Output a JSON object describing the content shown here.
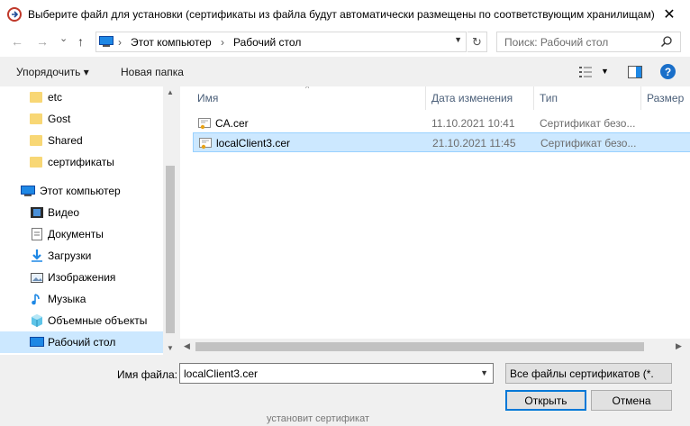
{
  "window": {
    "title": "Выберите файл для установки (сертификаты из файла будут автоматически размещены по соответствующим хранилищам)",
    "close_glyph": "✕"
  },
  "nav": {
    "back_glyph": "←",
    "forward_glyph": "→",
    "recent_glyph": "⌄",
    "up_glyph": "↑",
    "breadcrumbs": [
      "Этот компьютер",
      "Рабочий стол"
    ],
    "crumb_separator": "›",
    "refresh_glyph": "↻",
    "search_placeholder": "Поиск: Рабочий стол"
  },
  "toolbar": {
    "organize_label": "Упорядочить ▾",
    "new_folder_label": "Новая папка",
    "help_glyph": "?"
  },
  "sidebar": {
    "items": [
      {
        "label": "etc",
        "icon": "folder-icon"
      },
      {
        "label": "Gost",
        "icon": "folder-icon"
      },
      {
        "label": "Shared",
        "icon": "folder-icon"
      },
      {
        "label": "сертификаты",
        "icon": "folder-icon"
      },
      {
        "label": "Этот компьютер",
        "icon": "computer-icon"
      },
      {
        "label": "Видео",
        "icon": "video-icon"
      },
      {
        "label": "Документы",
        "icon": "documents-icon"
      },
      {
        "label": "Загрузки",
        "icon": "downloads-icon"
      },
      {
        "label": "Изображения",
        "icon": "pictures-icon"
      },
      {
        "label": "Музыка",
        "icon": "music-icon"
      },
      {
        "label": "Объемные объекты",
        "icon": "3d-objects-icon"
      },
      {
        "label": "Рабочий стол",
        "icon": "desktop-icon",
        "selected": true
      }
    ]
  },
  "filelist": {
    "columns": [
      "Имя",
      "Дата изменения",
      "Тип",
      "Размер"
    ],
    "rows": [
      {
        "name": "CA.cer",
        "date": "11.10.2021 10:41",
        "type": "Сертификат безо...",
        "size": "",
        "selected": false
      },
      {
        "name": "localClient3.cer",
        "date": "21.10.2021 11:45",
        "type": "Сертификат безо...",
        "size": "",
        "selected": true
      }
    ]
  },
  "footer": {
    "filename_label": "Имя файла:",
    "filename_value": "localClient3.cer",
    "filter_value": "Все файлы сертификатов (*.cer",
    "open_label": "Открыть",
    "cancel_label": "Отмена",
    "underlying_text": "установит сертификат"
  },
  "colors": {
    "selection": "#cce8ff",
    "selection_border": "#99d1ff",
    "accent": "#0078d7",
    "folder": "#f8d775"
  }
}
